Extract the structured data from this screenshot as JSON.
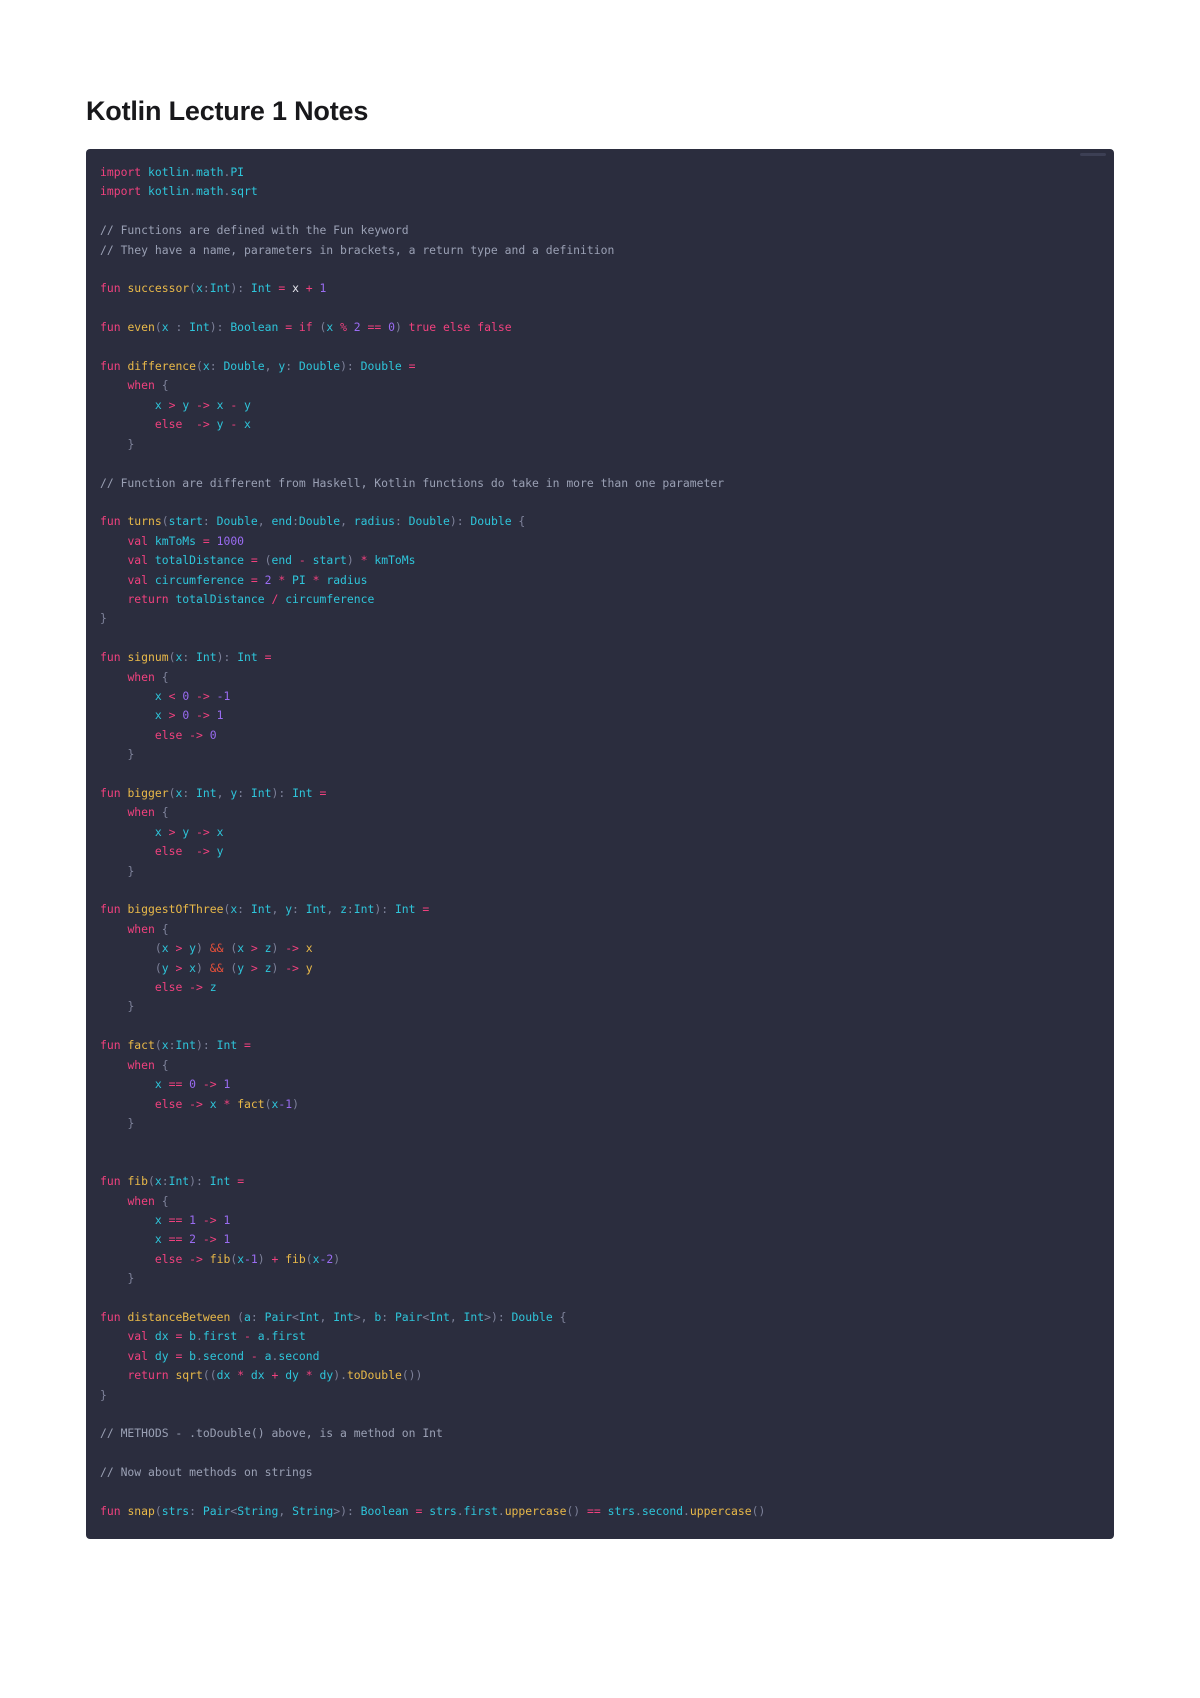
{
  "document": {
    "title": "Kotlin Lecture 1 Notes",
    "language": "kotlin"
  },
  "colors": {
    "page_background": "#ffffff",
    "code_background": "#2b2d3e",
    "title_color": "#18181b",
    "keyword": "#f0417e",
    "function_name": "#e9b949",
    "type": "#2ec5da",
    "identifier": "#2ec5da",
    "number": "#9a6cf2",
    "operator": "#f0417e",
    "logical_and": "#e8503a",
    "punctuation": "#7d8199",
    "comment": "#9aa0b4",
    "default_text": "#e6e6ef"
  },
  "code_block": {
    "lines": [
      "import kotlin.math.PI",
      "import kotlin.math.sqrt",
      "",
      "// Functions are defined with the Fun keyword",
      "// They have a name, parameters in brackets, a return type and a definition",
      "",
      "fun successor(x:Int): Int = x + 1",
      "",
      "fun even(x : Int): Boolean = if (x % 2 == 0) true else false",
      "",
      "fun difference(x: Double, y: Double): Double =",
      "    when {",
      "        x > y -> x - y",
      "        else  -> y - x",
      "    }",
      "",
      "// Function are different from Haskell, Kotlin functions do take in more than one parameter",
      "",
      "fun turns(start: Double, end:Double, radius: Double): Double {",
      "    val kmToMs = 1000",
      "    val totalDistance = (end - start) * kmToMs",
      "    val circumference = 2 * PI * radius",
      "    return totalDistance / circumference",
      "}",
      "",
      "fun signum(x: Int): Int =",
      "    when {",
      "        x < 0 -> -1",
      "        x > 0 -> 1",
      "        else -> 0",
      "    }",
      "",
      "fun bigger(x: Int, y: Int): Int =",
      "    when {",
      "        x > y -> x",
      "        else  -> y",
      "    }",
      "",
      "fun biggestOfThree(x: Int, y: Int, z:Int): Int =",
      "    when {",
      "        (x > y) && (x > z) -> x",
      "        (y > x) && (y > z) -> y",
      "        else -> z",
      "    }",
      "",
      "fun fact(x:Int): Int =",
      "    when {",
      "        x == 0 -> 1",
      "        else -> x * fact(x-1)",
      "    }",
      "",
      "",
      "fun fib(x:Int): Int =",
      "    when {",
      "        x == 1 -> 1",
      "        x == 2 -> 1",
      "        else -> fib(x-1) + fib(x-2)",
      "    }",
      "",
      "fun distanceBetween (a: Pair<Int, Int>, b: Pair<Int, Int>): Double {",
      "    val dx = b.first - a.first",
      "    val dy = b.second - a.second",
      "    return sqrt((dx * dx + dy * dy).toDouble())",
      "}",
      "",
      "// METHODS - .toDouble() above, is a method on Int",
      "",
      "// Now about methods on strings",
      "",
      "fun snap(strs: Pair<String, String>): Boolean = strs.first.uppercase() == strs.second.uppercase()"
    ]
  }
}
